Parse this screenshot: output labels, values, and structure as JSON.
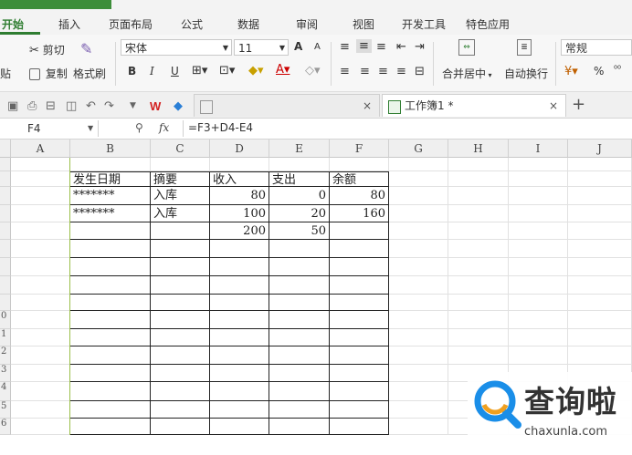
{
  "menu": {
    "tabs": [
      "开始",
      "插入",
      "页面布局",
      "公式",
      "数据",
      "审阅",
      "视图",
      "开发工具",
      "特色应用"
    ],
    "active_index": 0
  },
  "ribbon": {
    "cut": "剪切",
    "paste": "贴",
    "copy": "复制",
    "format_painter": "格式刷",
    "font_name": "宋体",
    "font_size": "11",
    "grow_font": "A",
    "shrink_font": "A",
    "bold": "B",
    "italic": "I",
    "underline": "U",
    "merge_center": "合并居中",
    "wrap_text": "自动换行",
    "number_format": "常规",
    "percent": "%"
  },
  "tabs_bar": {
    "workbook_tab": "工作簿1 *",
    "close_glyph": "×",
    "add_glyph": "+"
  },
  "formula_bar": {
    "cell_ref": "F4",
    "fx": "fx",
    "formula": "=F3+D4-E4"
  },
  "grid": {
    "columns": [
      "A",
      "B",
      "C",
      "D",
      "E",
      "F",
      "G",
      "H",
      "I",
      "J"
    ],
    "row_labels": [
      "",
      "",
      "",
      "",
      "",
      "",
      "",
      "",
      "",
      "0",
      "1",
      "2",
      "3",
      "4",
      "5",
      "6"
    ],
    "header": [
      "发生日期",
      "摘要",
      "收入",
      "支出",
      "余额"
    ],
    "rows": [
      {
        "date": "*******",
        "summary": "入库",
        "income": "80",
        "expense": "0",
        "balance": "80"
      },
      {
        "date": "*******",
        "summary": "入库",
        "income": "100",
        "expense": "20",
        "balance": "160"
      },
      {
        "date": "",
        "summary": "",
        "income": "200",
        "expense": "50",
        "balance": ""
      }
    ]
  },
  "watermark": {
    "brand": "查询啦",
    "domain": "chaxunla.com"
  },
  "colors": {
    "accent_green": "#2f7d31",
    "logo_blue": "#1a8ee8"
  }
}
